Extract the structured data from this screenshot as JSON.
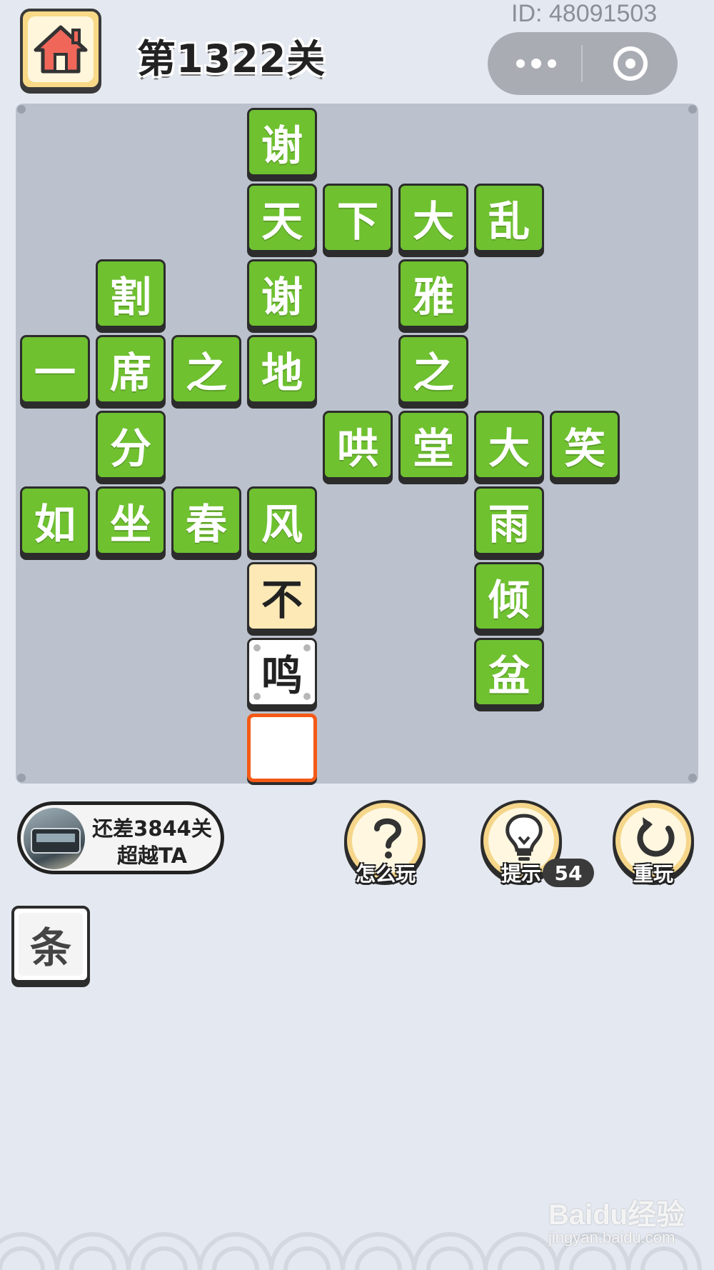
{
  "header": {
    "user_id": "ID: 48091503",
    "level_title": "第1322关"
  },
  "board": {
    "tiles": [
      {
        "char": "谢",
        "state": "green",
        "col": 3,
        "row": 0
      },
      {
        "char": "天",
        "state": "green",
        "col": 3,
        "row": 1
      },
      {
        "char": "下",
        "state": "green",
        "col": 4,
        "row": 1
      },
      {
        "char": "大",
        "state": "green",
        "col": 5,
        "row": 1
      },
      {
        "char": "乱",
        "state": "green",
        "col": 6,
        "row": 1
      },
      {
        "char": "割",
        "state": "green",
        "col": 1,
        "row": 2
      },
      {
        "char": "谢",
        "state": "green",
        "col": 3,
        "row": 2
      },
      {
        "char": "雅",
        "state": "green",
        "col": 5,
        "row": 2
      },
      {
        "char": "一",
        "state": "green",
        "col": 0,
        "row": 3
      },
      {
        "char": "席",
        "state": "green",
        "col": 1,
        "row": 3
      },
      {
        "char": "之",
        "state": "green",
        "col": 2,
        "row": 3
      },
      {
        "char": "地",
        "state": "green",
        "col": 3,
        "row": 3
      },
      {
        "char": "之",
        "state": "green",
        "col": 5,
        "row": 3
      },
      {
        "char": "分",
        "state": "green",
        "col": 1,
        "row": 4
      },
      {
        "char": "哄",
        "state": "green",
        "col": 4,
        "row": 4
      },
      {
        "char": "堂",
        "state": "green",
        "col": 5,
        "row": 4
      },
      {
        "char": "大",
        "state": "green",
        "col": 6,
        "row": 4
      },
      {
        "char": "笑",
        "state": "green",
        "col": 7,
        "row": 4
      },
      {
        "char": "如",
        "state": "green",
        "col": 0,
        "row": 5
      },
      {
        "char": "坐",
        "state": "green",
        "col": 1,
        "row": 5
      },
      {
        "char": "春",
        "state": "green",
        "col": 2,
        "row": 5
      },
      {
        "char": "风",
        "state": "green",
        "col": 3,
        "row": 5
      },
      {
        "char": "雨",
        "state": "green",
        "col": 6,
        "row": 5
      },
      {
        "char": "不",
        "state": "hint",
        "col": 3,
        "row": 6
      },
      {
        "char": "倾",
        "state": "green",
        "col": 6,
        "row": 6
      },
      {
        "char": "鸣",
        "state": "filled",
        "col": 3,
        "row": 7
      },
      {
        "char": "盆",
        "state": "green",
        "col": 6,
        "row": 7
      },
      {
        "char": "",
        "state": "empty",
        "col": 3,
        "row": 8
      }
    ]
  },
  "player": {
    "line1": "还差3844关",
    "line2": "超越TA"
  },
  "actions": {
    "help_label": "怎么玩",
    "hint_label": "提示",
    "hint_count": "54",
    "replay_label": "重玩"
  },
  "options": [
    {
      "char": "条"
    }
  ],
  "watermark": {
    "brand": "Baidu经验",
    "url": "jingyan.baidu.com"
  },
  "colors": {
    "tile_green": "#6fc130",
    "tile_hint": "#fde9b6",
    "active_border": "#f45a16",
    "board_bg": "#bcc2cd",
    "page_bg": "#e4e8f0"
  },
  "icons": {
    "home": "home-icon",
    "more": "more-dots-icon",
    "close": "target-circle-icon",
    "help": "question-mark-icon",
    "hint": "lightbulb-icon",
    "replay": "refresh-icon"
  }
}
